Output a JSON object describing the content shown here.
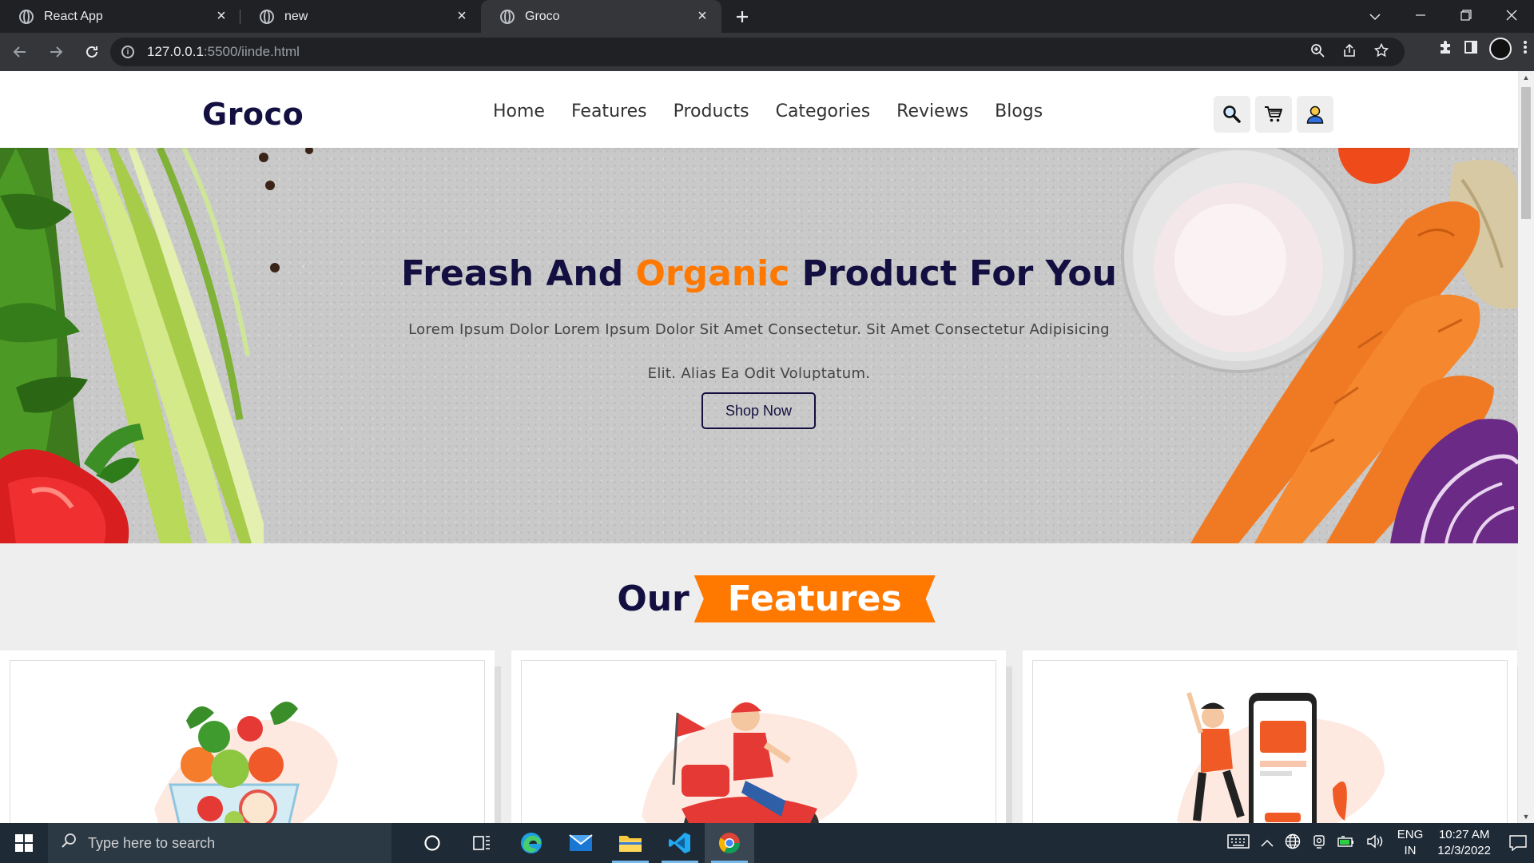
{
  "browser": {
    "tabs": [
      {
        "title": "React App",
        "active": false
      },
      {
        "title": "new",
        "active": false
      },
      {
        "title": "Groco",
        "active": true
      }
    ],
    "new_tab_icon": "plus-icon",
    "url_host": "127.0.0.1",
    "url_path": ":5500/iinde.html"
  },
  "site": {
    "logo": "Groco",
    "nav": [
      "Home",
      "Features",
      "Products",
      "Categories",
      "Reviews",
      "Blogs"
    ],
    "header_icons": [
      "search-icon",
      "cart-icon",
      "user-icon"
    ],
    "hero": {
      "title_part1": "Freash And ",
      "title_accent": "Organic",
      "title_part2": " Product For You",
      "description": "Lorem Ipsum Dolor Lorem Ipsum Dolor Sit Amet Consectetur. Sit Amet Consectetur Adipisicing Elit. Alias Ea Odit Voluptatum.",
      "button": "Shop Now"
    },
    "features": {
      "heading_our": "Our",
      "heading_features": "Features"
    },
    "colors": {
      "brand_dark": "#130f40",
      "accent": "#ff7800"
    }
  },
  "taskbar": {
    "search_placeholder": "Type here to search",
    "lang_line1": "ENG",
    "lang_line2": "IN",
    "time": "10:27 AM",
    "date": "12/3/2022"
  }
}
